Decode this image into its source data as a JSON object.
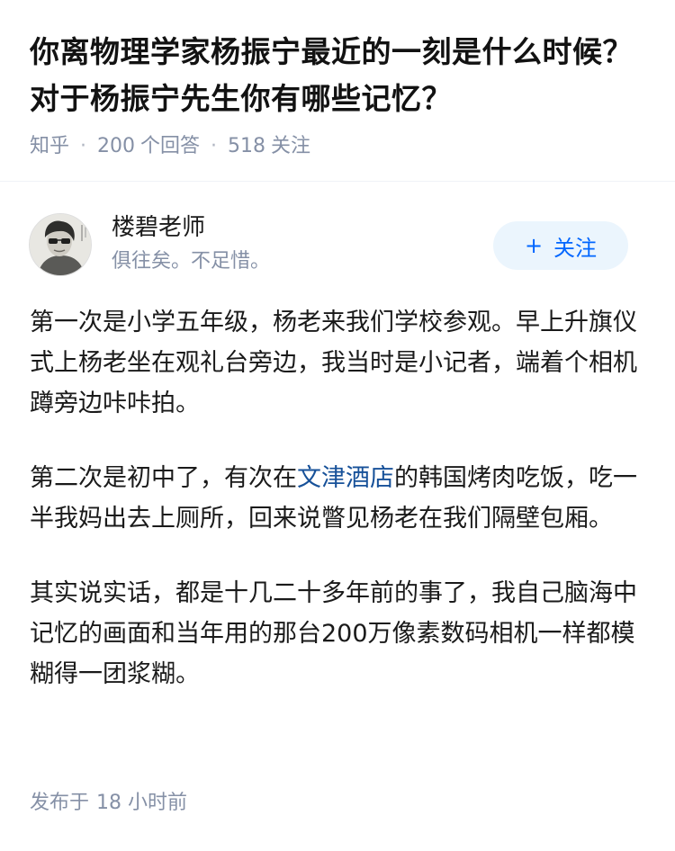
{
  "question": {
    "title": "你离物理学家杨振宁最近的一刻是什么时候？对于杨振宁先生你有哪些记忆？",
    "site": "知乎",
    "answer_count": "200",
    "answer_label": "个回答",
    "follower_count": "518",
    "follower_label": "关注"
  },
  "author": {
    "name": "楼碧老师",
    "bio": "俱往矣。不足惜。",
    "follow_label": "关注",
    "follow_icon": "plus-icon"
  },
  "answer": {
    "paragraphs": [
      {
        "text": "第一次是小学五年级，杨老来我们学校参观。早上升旗仪式上杨老坐在观礼台旁边，我当时是小记者，端着个相机蹲旁边咔咔拍。"
      },
      {
        "before": "第二次是初中了，有次在",
        "link": "文津酒店",
        "after": "的韩国烤肉吃饭，吃一半我妈出去上厕所，回来说瞥见杨老在我们隔壁包厢。"
      },
      {
        "text": "其实说实话，都是十几二十多年前的事了，我自己脑海中记忆的画面和当年用的那台200万像素数码相机一样都模糊得一团浆糊。"
      }
    ],
    "publish_label": "发布于",
    "publish_time": "18 小时前"
  },
  "colors": {
    "meta_gray": "#8590a6",
    "link": "#175199",
    "follow_text": "#0066ff",
    "follow_bg": "#ebf5fd"
  }
}
